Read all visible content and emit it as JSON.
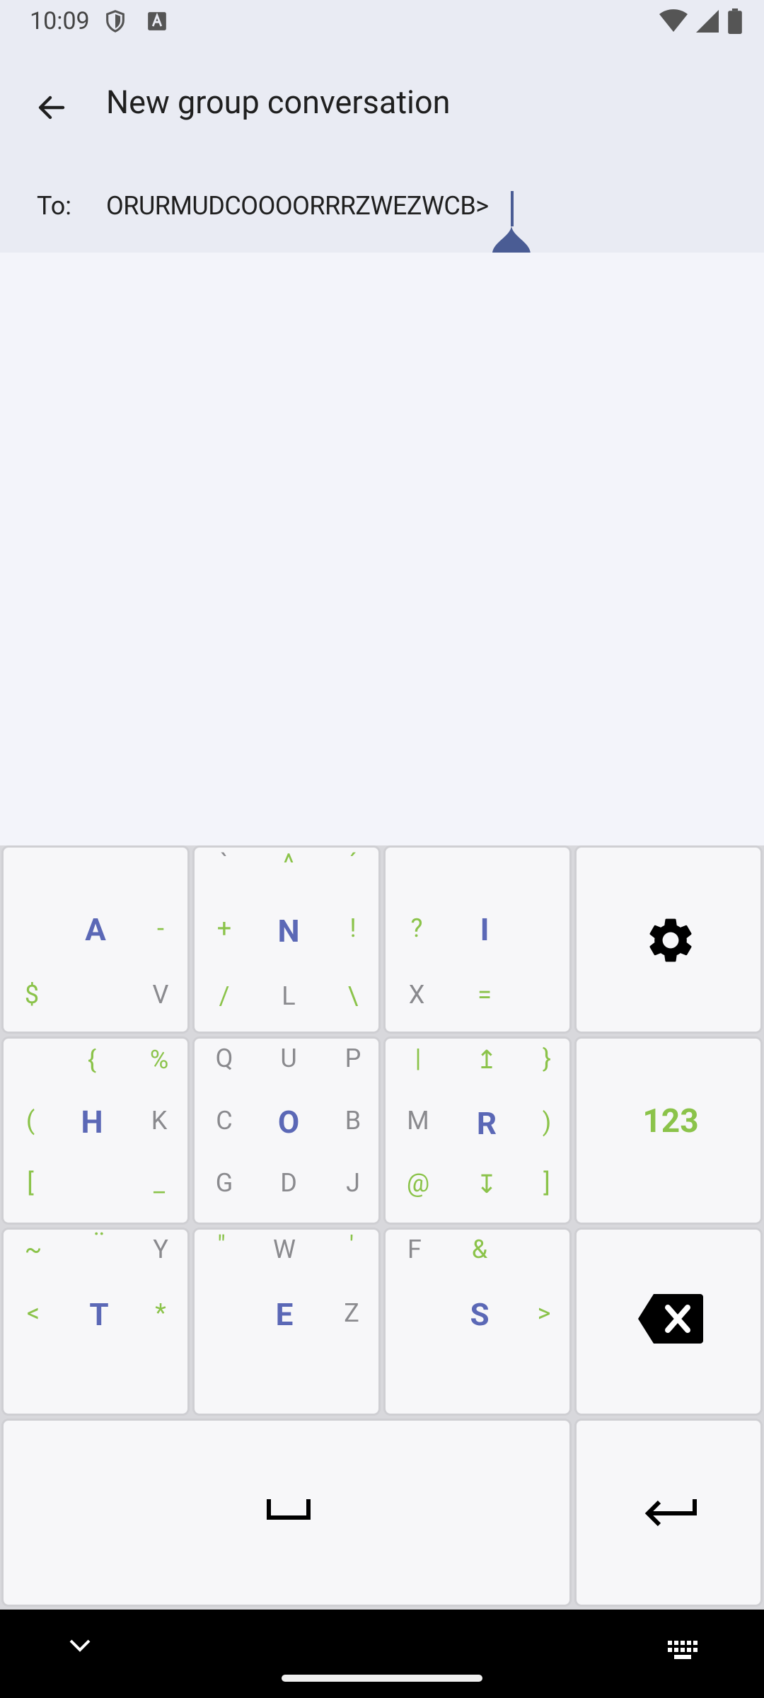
{
  "status_bar": {
    "time": "10:09"
  },
  "header": {
    "title": "New group conversation"
  },
  "recipient": {
    "label": "To:",
    "value": "ORURMUDCOOOORRRZWEZWCB>"
  },
  "keyboard": {
    "key_a": {
      "main": "A",
      "top_right": "-",
      "bottom_left": "$",
      "bottom_right": "V"
    },
    "key_n": {
      "main": "N",
      "top_left": "`",
      "top": "^",
      "top_right": "´",
      "left": "+",
      "right": "!",
      "bottom_left": "/",
      "bottom": "L",
      "bottom_right": "\\"
    },
    "key_i": {
      "main": "I",
      "left": "?",
      "bottom_left": "X",
      "bottom": "="
    },
    "key_h": {
      "main": "H",
      "top": "{",
      "top_right": "%",
      "left": "(",
      "right": "K",
      "bottom_left": "[",
      "bottom_right": "_"
    },
    "key_o": {
      "main": "O",
      "top_left": "Q",
      "top": "U",
      "top_right": "P",
      "left": "C",
      "right": "B",
      "bottom_left": "G",
      "bottom": "D",
      "bottom_right": "J"
    },
    "key_r": {
      "main": "R",
      "top_left": "|",
      "top": "↥",
      "top_right": "}",
      "left": "M",
      "right": ")",
      "bottom_left": "@",
      "bottom": "↧",
      "bottom_right": "]"
    },
    "key_123": {
      "label": "123"
    },
    "key_t": {
      "main": "T",
      "top_left": "~",
      "top": "¨",
      "top_right": "Y",
      "left": "<",
      "right": "*"
    },
    "key_e": {
      "main": "E",
      "top_left": "\"",
      "top": "W",
      "top_right": "'",
      "right": "Z"
    },
    "key_s": {
      "main": "S",
      "top_left": "F",
      "top": "&",
      "right": ">"
    }
  },
  "icons": [
    "back-arrow-icon",
    "gear-icon",
    "backspace-icon",
    "space-icon",
    "enter-icon",
    "chevron-down-icon",
    "keyboard-icon",
    "wifi-icon",
    "signal-icon",
    "battery-icon",
    "shield-icon"
  ],
  "colors": {
    "accent": "#5b68b6",
    "secondary": "#8bc34a",
    "background": "#f3f4fa",
    "header": "#e9ebf3"
  }
}
